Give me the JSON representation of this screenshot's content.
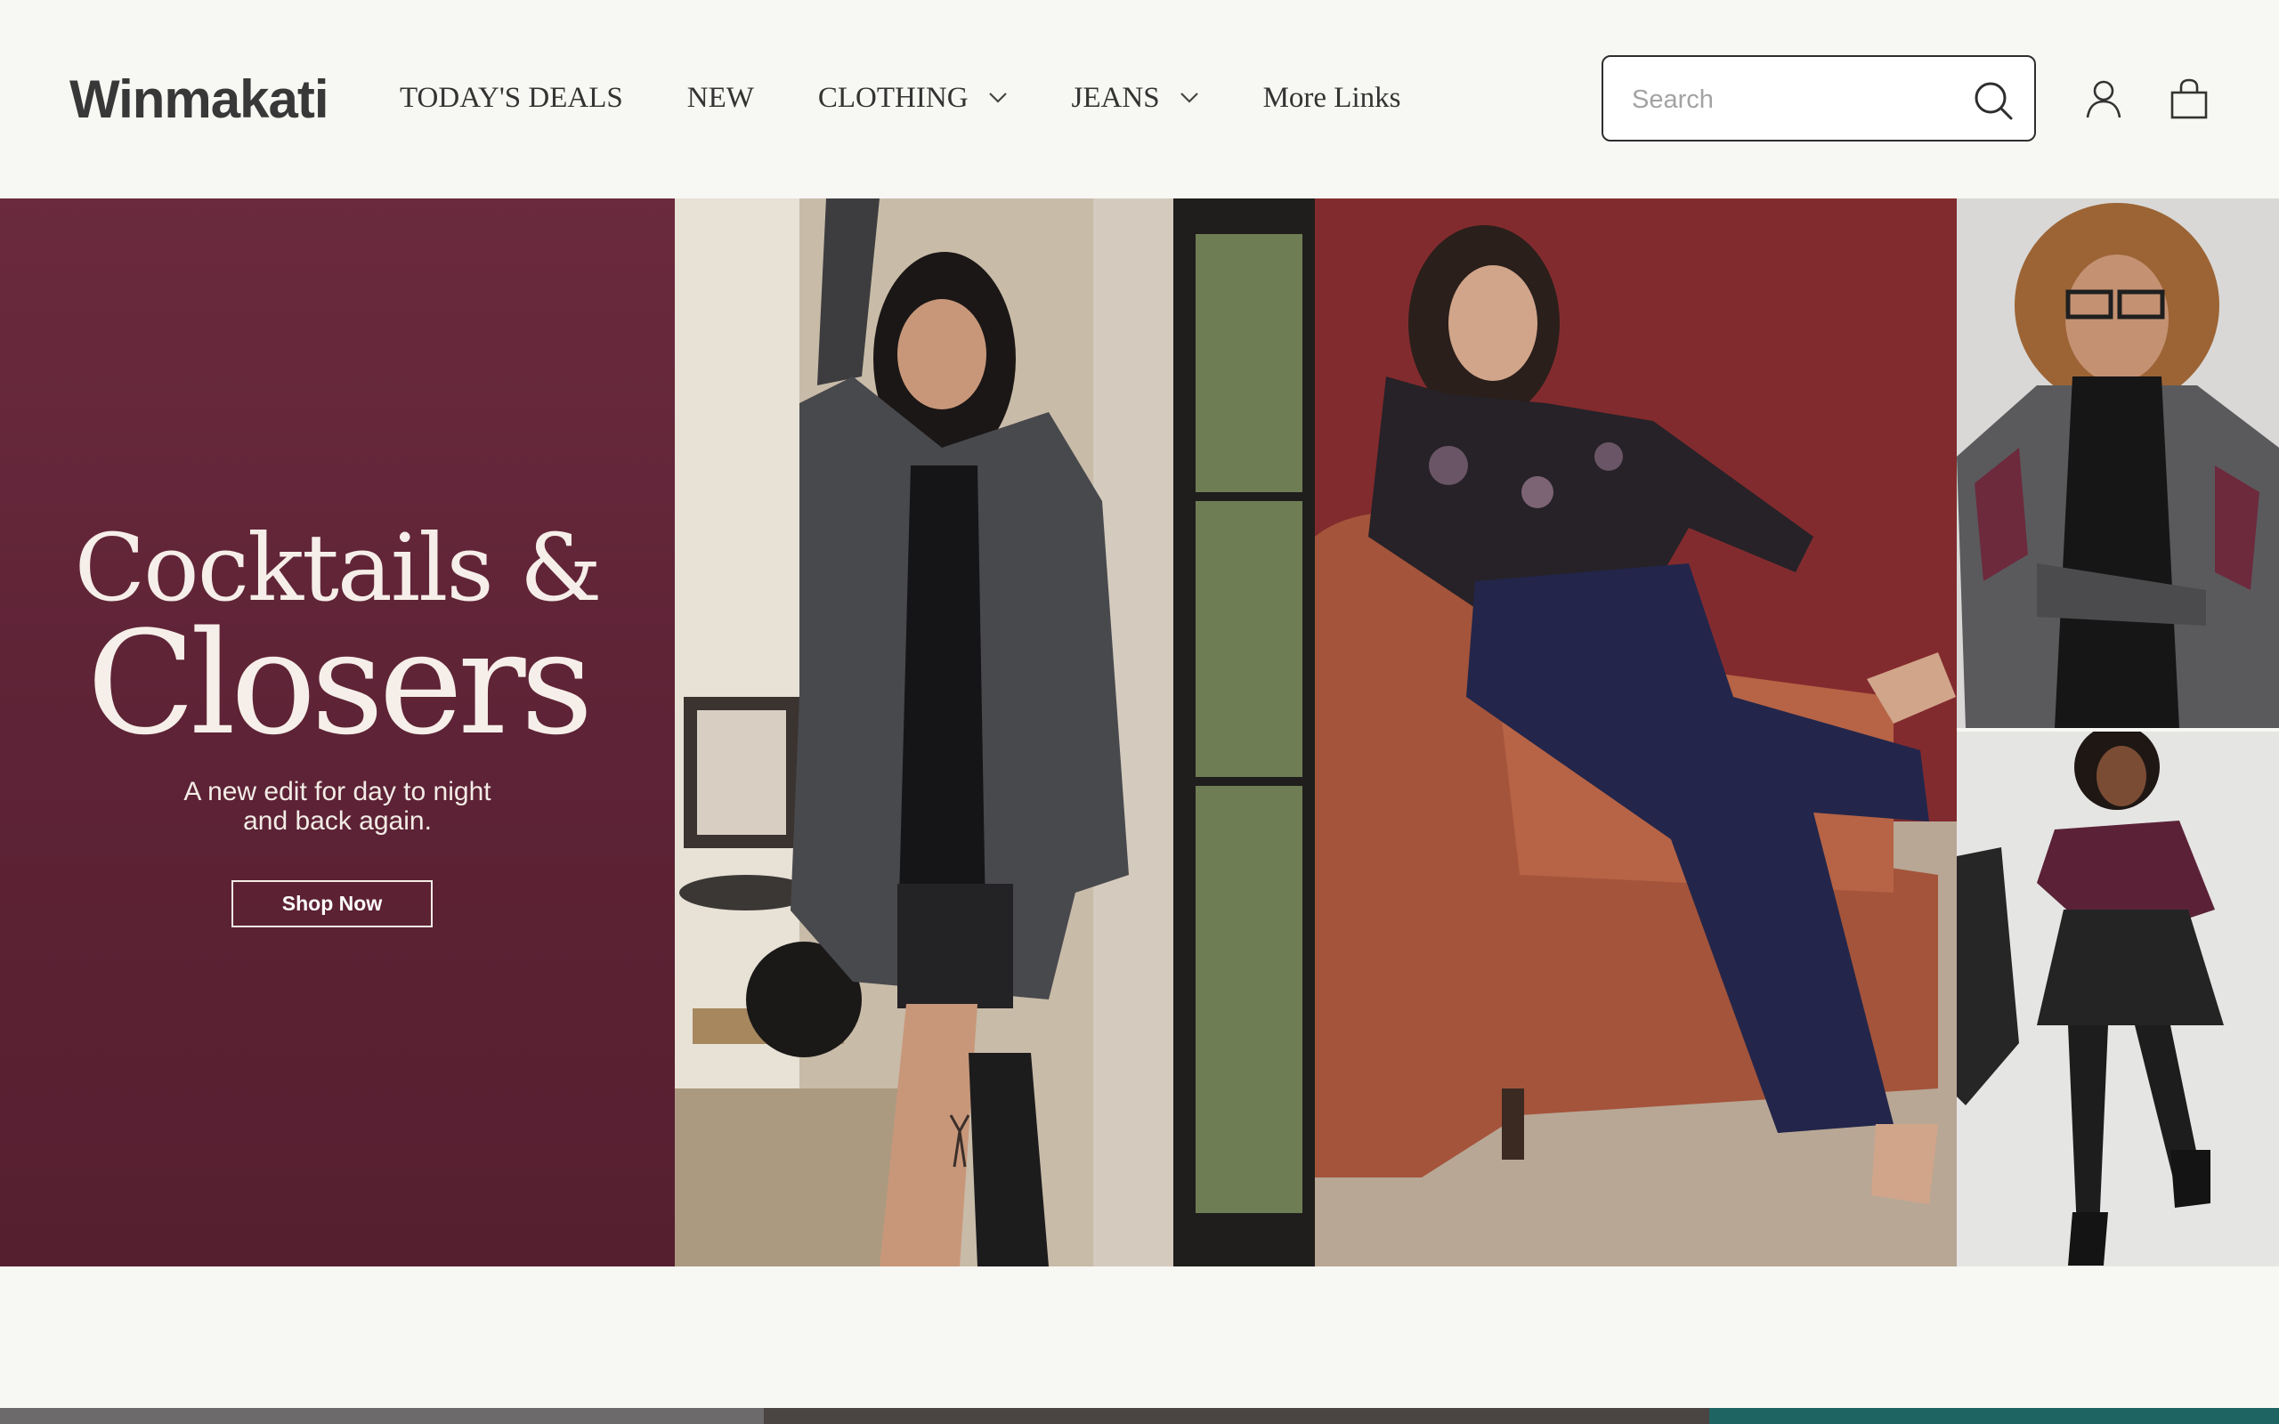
{
  "brand": {
    "logo_text": "Winmakati"
  },
  "nav": {
    "items": [
      {
        "label": "TODAY'S DEALS",
        "has_dropdown": false
      },
      {
        "label": "NEW",
        "has_dropdown": false
      },
      {
        "label": "CLOTHING",
        "has_dropdown": true
      },
      {
        "label": "JEANS",
        "has_dropdown": true
      },
      {
        "label": "More Links",
        "has_dropdown": false
      }
    ]
  },
  "search": {
    "placeholder": "Search",
    "value": "",
    "icon": "search-icon"
  },
  "header_icons": {
    "account": "user-icon",
    "cart": "shopping-bag-icon"
  },
  "hero": {
    "title_line1": "Cocktails &",
    "title_line2": "Closers",
    "subtitle_line1": "A new edit for day to night",
    "subtitle_line2": "and back again.",
    "cta_label": "Shop Now",
    "colors": {
      "promo_bg": "#5e2336",
      "text": "#f6efe9"
    }
  },
  "colors": {
    "page_bg": "#f7f7f3",
    "text_dark": "#333333",
    "accent_teal": "#1d6463"
  }
}
